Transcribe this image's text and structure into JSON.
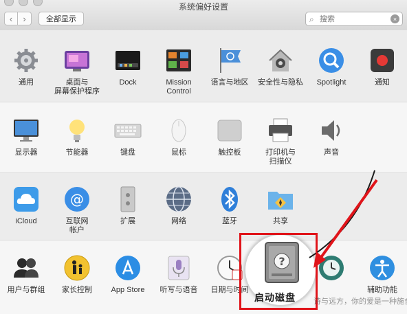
{
  "window": {
    "title": "系统偏好设置"
  },
  "toolbar": {
    "back_icon": "chevron-left-icon",
    "forward_icon": "chevron-right-icon",
    "show_all_label": "全部显示",
    "search_placeholder": "搜索"
  },
  "rows": [
    {
      "items": [
        {
          "label": "通用",
          "icon": "gear-icon"
        },
        {
          "label": "桌面与\n屏幕保护程序",
          "icon": "desktop-icon"
        },
        {
          "label": "Dock",
          "icon": "dock-icon"
        },
        {
          "label": "Mission\nControl",
          "icon": "mission-control-icon"
        },
        {
          "label": "语言与地区",
          "icon": "flag-icon"
        },
        {
          "label": "安全性与隐私",
          "icon": "house-lock-icon"
        },
        {
          "label": "Spotlight",
          "icon": "spotlight-icon"
        },
        {
          "label": "通知",
          "icon": "notifications-icon"
        }
      ]
    },
    {
      "items": [
        {
          "label": "显示器",
          "icon": "display-icon"
        },
        {
          "label": "节能器",
          "icon": "lightbulb-icon"
        },
        {
          "label": "键盘",
          "icon": "keyboard-icon"
        },
        {
          "label": "鼠标",
          "icon": "mouse-icon"
        },
        {
          "label": "触控板",
          "icon": "trackpad-icon"
        },
        {
          "label": "打印机与\n扫描仪",
          "icon": "printer-icon"
        },
        {
          "label": "声音",
          "icon": "speaker-icon"
        }
      ]
    },
    {
      "items": [
        {
          "label": "iCloud",
          "icon": "icloud-icon"
        },
        {
          "label": "互联网\n帐户",
          "icon": "at-sign-icon"
        },
        {
          "label": "扩展",
          "icon": "extensions-icon"
        },
        {
          "label": "网络",
          "icon": "globe-icon"
        },
        {
          "label": "蓝牙",
          "icon": "bluetooth-icon"
        },
        {
          "label": "共享",
          "icon": "shared-folder-icon"
        }
      ]
    },
    {
      "items": [
        {
          "label": "用户与群组",
          "icon": "users-icon"
        },
        {
          "label": "家长控制",
          "icon": "parental-controls-icon"
        },
        {
          "label": "App Store",
          "icon": "app-store-icon"
        },
        {
          "label": "听写与语音",
          "icon": "microphone-icon"
        },
        {
          "label": "日期与时间",
          "icon": "clock-icon"
        },
        {
          "label": "",
          "icon": "startup-disk-icon"
        },
        {
          "label": "",
          "icon": "time-machine-icon"
        },
        {
          "label": "辅助功能",
          "icon": "accessibility-icon"
        }
      ]
    }
  ],
  "startup_disk": {
    "label": "启动磁盘",
    "icon": "startup-disk-icon"
  },
  "annotation": {
    "arrow_color": "#e0141a",
    "box_color": "#e0141a"
  },
  "watermark": "诗与远方，你的爱是一种施舍"
}
